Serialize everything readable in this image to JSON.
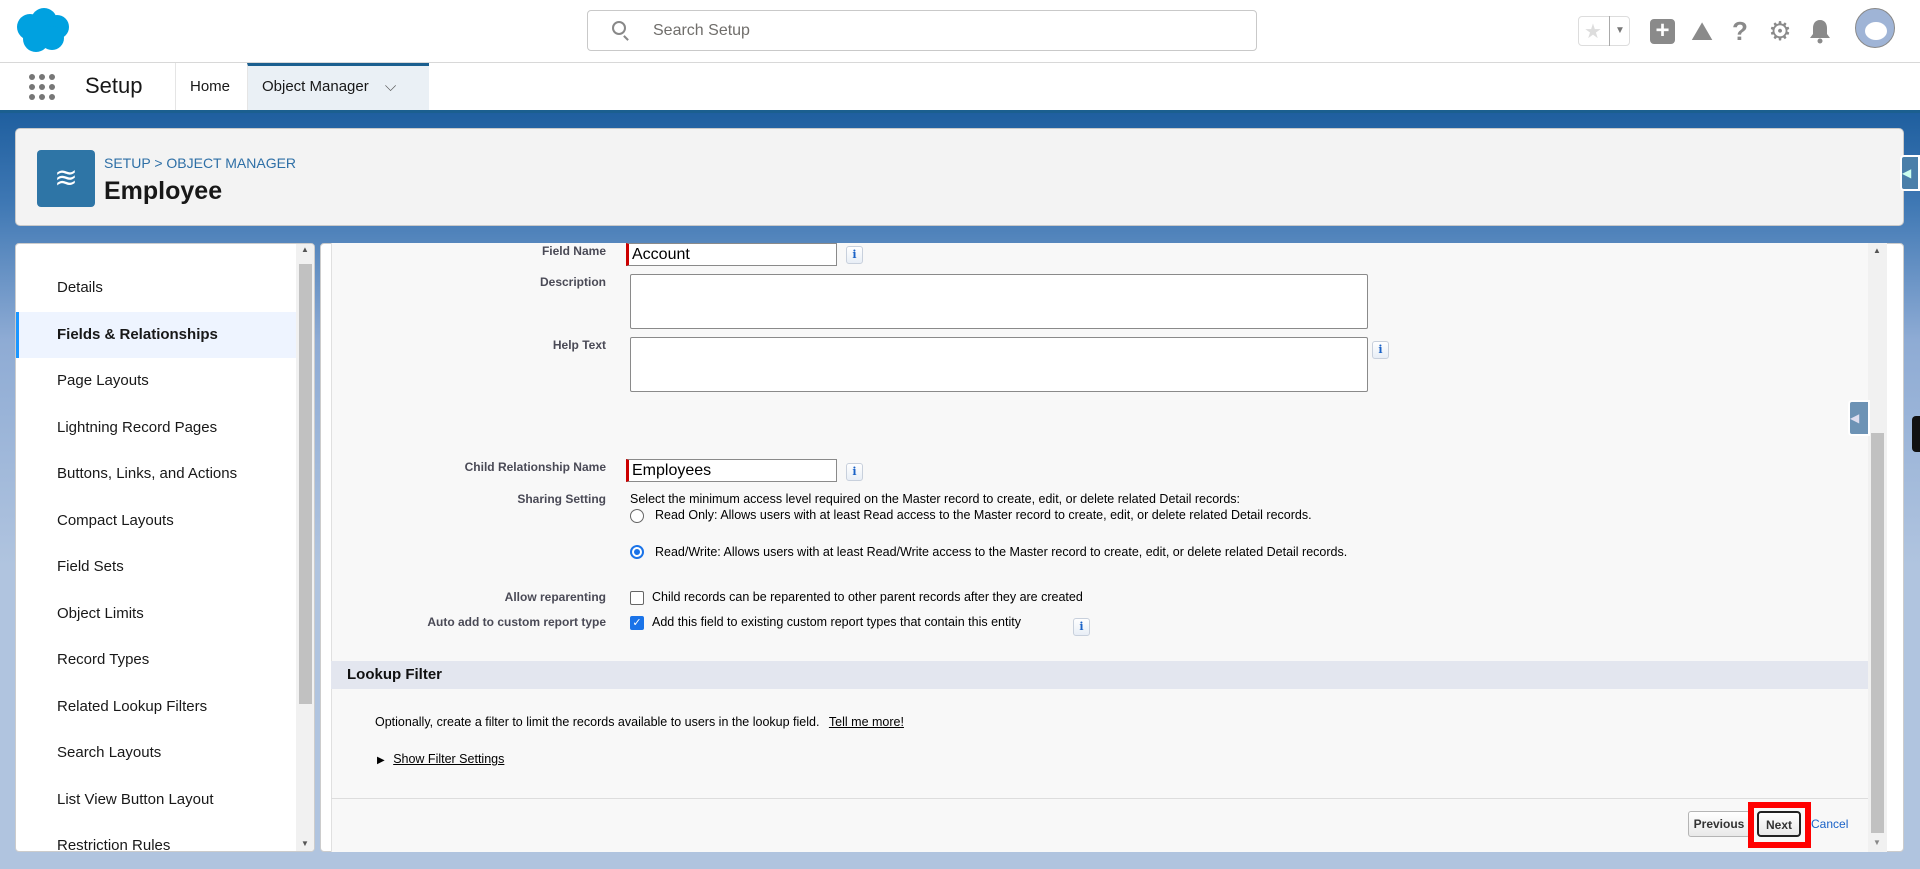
{
  "header": {
    "search_placeholder": "Search Setup",
    "brand_color": "#00a1e0"
  },
  "icons": [
    "salesforce-logo",
    "search-icon",
    "favorite-star-icon",
    "favorites-dropdown-icon",
    "global-add-icon",
    "trailhead-icon",
    "help-icon",
    "setup-gear-icon",
    "notification-bell-icon",
    "avatar"
  ],
  "nav": {
    "app_name": "Setup",
    "tabs": [
      {
        "label": "Home"
      },
      {
        "label": "Object Manager",
        "active": true
      }
    ]
  },
  "page_header": {
    "breadcrumb": "SETUP > OBJECT MANAGER",
    "title": "Employee"
  },
  "sidebar": {
    "items": [
      {
        "label": "Details"
      },
      {
        "label": "Fields & Relationships",
        "selected": true
      },
      {
        "label": "Page Layouts"
      },
      {
        "label": "Lightning Record Pages"
      },
      {
        "label": "Buttons, Links, and Actions"
      },
      {
        "label": "Compact Layouts"
      },
      {
        "label": "Field Sets"
      },
      {
        "label": "Object Limits"
      },
      {
        "label": "Record Types"
      },
      {
        "label": "Related Lookup Filters"
      },
      {
        "label": "Search Layouts"
      },
      {
        "label": "List View Button Layout"
      },
      {
        "label": "Restriction Rules"
      }
    ]
  },
  "form": {
    "field_name_label": "Field Name",
    "field_name_value": "Account",
    "description_label": "Description",
    "description_value": "",
    "help_text_label": "Help Text",
    "help_text_value": "",
    "child_rel_label": "Child Relationship Name",
    "child_rel_value": "Employees",
    "sharing_label": "Sharing Setting",
    "sharing_intro": "Select the minimum access level required on the Master record to create, edit, or delete related Detail records:",
    "sharing_read_only": "Read Only: Allows users with at least Read access to the Master record to create, edit, or delete related Detail records.",
    "sharing_read_write": "Read/Write: Allows users with at least Read/Write access to the Master record to create, edit, or delete related Detail records.",
    "sharing_selected": "Read/Write",
    "reparent_label": "Allow reparenting",
    "reparent_text": "Child records can be reparented to other parent records after they are created",
    "reparent_checked": false,
    "auto_add_label": "Auto add to custom report type",
    "auto_add_text": "Add this field to existing custom report types that contain this entity",
    "auto_add_checked": true,
    "info_glyph": "i"
  },
  "lookup_filter": {
    "title": "Lookup Filter",
    "description": "Optionally, create a filter to limit the records available to users in the lookup field.",
    "tell_me_more": "Tell me more!",
    "show_settings": "Show Filter Settings"
  },
  "footer": {
    "previous": "Previous",
    "next": "Next",
    "cancel": "Cancel",
    "highlight_color": "#ff0000"
  }
}
